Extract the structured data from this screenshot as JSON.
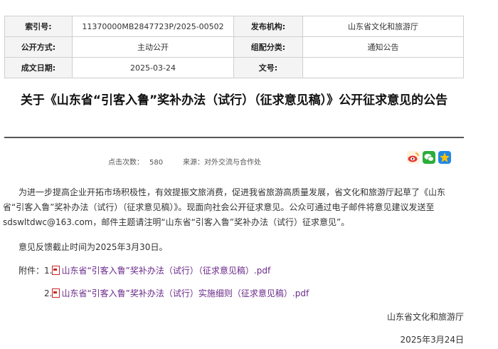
{
  "meta": {
    "index_label": "索引号:",
    "index_value": "11370000MB2847723P/2025-00502",
    "org_label": "发布机构:",
    "org_value": "山东省文化和旅游厅",
    "open_label": "公开方式:",
    "open_value": "主动公开",
    "category_label": "组配分类:",
    "category_value": "通知公告",
    "date_label": "成文日期:",
    "date_value": "2025-03-24",
    "doc_label": "文号:",
    "doc_value": ""
  },
  "article": {
    "title": "关于《山东省“引客入鲁”奖补办法（试行）（征求意见稿）》公开征求意见的公告",
    "views_label": "点击次数：",
    "views": "580",
    "source_label": "来源：",
    "source": "对外交流与合作处",
    "paragraph1": "为进一步提高企业开拓市场积极性，有效提振文旅消费，促进我省旅游高质量发展，省文化和旅游厅起草了《山东省“引客入鲁”奖补办法（试行）（征求意见稿）》。现面向社会公开征求意见。公众可通过电子邮件将意见建议发送至sdswltdwc@163.com，邮件主题请注明“山东省“引客入鲁”奖补办法（试行）征求意见”。",
    "paragraph2": "意见反馈截止时间为2025年3月30日。",
    "attachments_label": "附件：",
    "attachments": [
      {
        "number": "1.",
        "name": "山东省“引客入鲁”奖补办法（试行）（征求意见稿）.pdf"
      },
      {
        "number": "2.",
        "name": "山东省“引客入鲁”奖补办法（试行）实施细则（征求意见稿）.pdf"
      }
    ],
    "signature_org": "山东省文化和旅游厅",
    "signature_date": "2025年3月24日"
  },
  "icons": [
    "weibo-icon",
    "wechat-icon",
    "favorite-star-icon"
  ],
  "colors": {
    "link": "#6a2a8a",
    "label_bg": "#f4f4f4",
    "pdf": "#c62828"
  }
}
